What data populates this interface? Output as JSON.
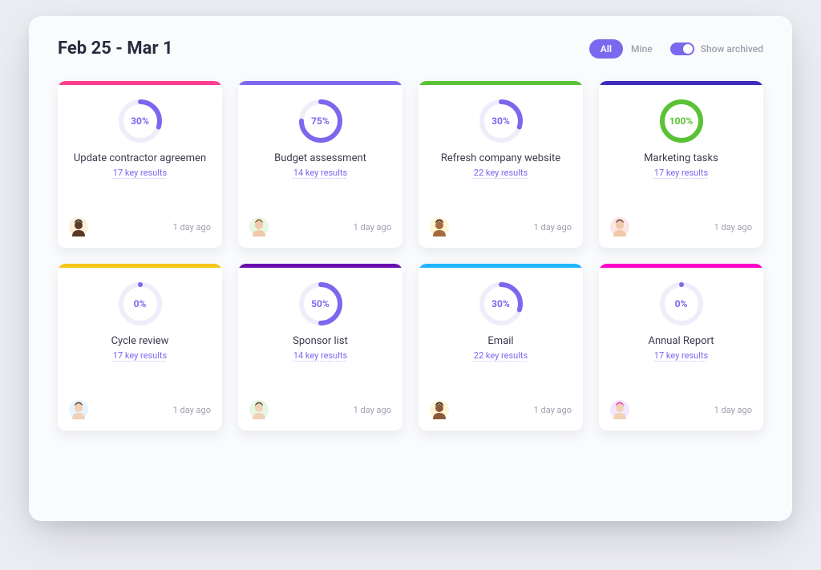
{
  "header": {
    "title": "Feb 25 - Mar 1",
    "filter": {
      "active": "All",
      "inactive": "Mine"
    },
    "toggle": {
      "label": "Show archived",
      "on": true
    }
  },
  "colors": {
    "purple": "#7b68ee",
    "green": "#5bc236",
    "track": "#eeeefb",
    "accents": {
      "pink": "#ff3e8f",
      "purple": "#7b68ee",
      "lightgreen": "#5bc236",
      "darkpurple": "#3d2bbd",
      "yellow": "#f5c518",
      "violet": "#6a0dad",
      "cyan": "#1fb6ff",
      "magenta": "#ff00c8"
    }
  },
  "cards": [
    {
      "title": "Update contractor agreemen",
      "keyResults": "17 key results",
      "percent": 30,
      "ringColor": "#7b68ee",
      "percentColor": "#7b68ee",
      "topColor": "#ff3e8f",
      "time": "1 day ago",
      "avatar": {
        "bg": "#fcefdc",
        "skin": "#5a3a24",
        "hair": "#1b1b1b"
      }
    },
    {
      "title": "Budget assessment",
      "keyResults": "14 key results",
      "percent": 75,
      "ringColor": "#7b68ee",
      "percentColor": "#7b68ee",
      "topColor": "#7b68ee",
      "time": "1 day ago",
      "avatar": {
        "bg": "#e8f7e4",
        "skin": "#efc9a9",
        "hair": "#8a5a2a"
      }
    },
    {
      "title": "Refresh company website",
      "keyResults": "22 key results",
      "percent": 30,
      "ringColor": "#7b68ee",
      "percentColor": "#7b68ee",
      "topColor": "#5bc236",
      "time": "1 day ago",
      "avatar": {
        "bg": "#fff5d6",
        "skin": "#a36b3f",
        "hair": "#2b1a0f"
      }
    },
    {
      "title": "Marketing tasks",
      "keyResults": "17 key results",
      "percent": 100,
      "ringColor": "#5bc236",
      "percentColor": "#5bc236",
      "topColor": "#3d2bbd",
      "time": "1 day ago",
      "avatar": {
        "bg": "#ffe6e6",
        "skin": "#efc9a9",
        "hair": "#6b4a2a"
      }
    },
    {
      "title": "Cycle review",
      "keyResults": "17 key results",
      "percent": 0,
      "ringColor": "#7b68ee",
      "percentColor": "#7b68ee",
      "topColor": "#f5c518",
      "time": "1 day ago",
      "avatar": {
        "bg": "#e6f4ff",
        "skin": "#f1d0b5",
        "hair": "#6b4a2a"
      }
    },
    {
      "title": "Sponsor list",
      "keyResults": "14 key results",
      "percent": 50,
      "ringColor": "#7b68ee",
      "percentColor": "#7b68ee",
      "topColor": "#6a0dad",
      "time": "1 day ago",
      "avatar": {
        "bg": "#e8f7e4",
        "skin": "#f0d2b8",
        "hair": "#6b4a2a"
      }
    },
    {
      "title": "Email",
      "keyResults": "22 key results",
      "percent": 30,
      "ringColor": "#7b68ee",
      "percentColor": "#7b68ee",
      "topColor": "#1fb6ff",
      "time": "1 day ago",
      "avatar": {
        "bg": "#fff5d6",
        "skin": "#8a5a3a",
        "hair": "#1b1b1b"
      }
    },
    {
      "title": "Annual Report",
      "keyResults": "17 key results",
      "percent": 0,
      "ringColor": "#7b68ee",
      "percentColor": "#7b68ee",
      "topColor": "#ff00c8",
      "time": "1 day ago",
      "avatar": {
        "bg": "#f3e6ff",
        "skin": "#f0d2b8",
        "hair": "#e84393"
      }
    }
  ]
}
